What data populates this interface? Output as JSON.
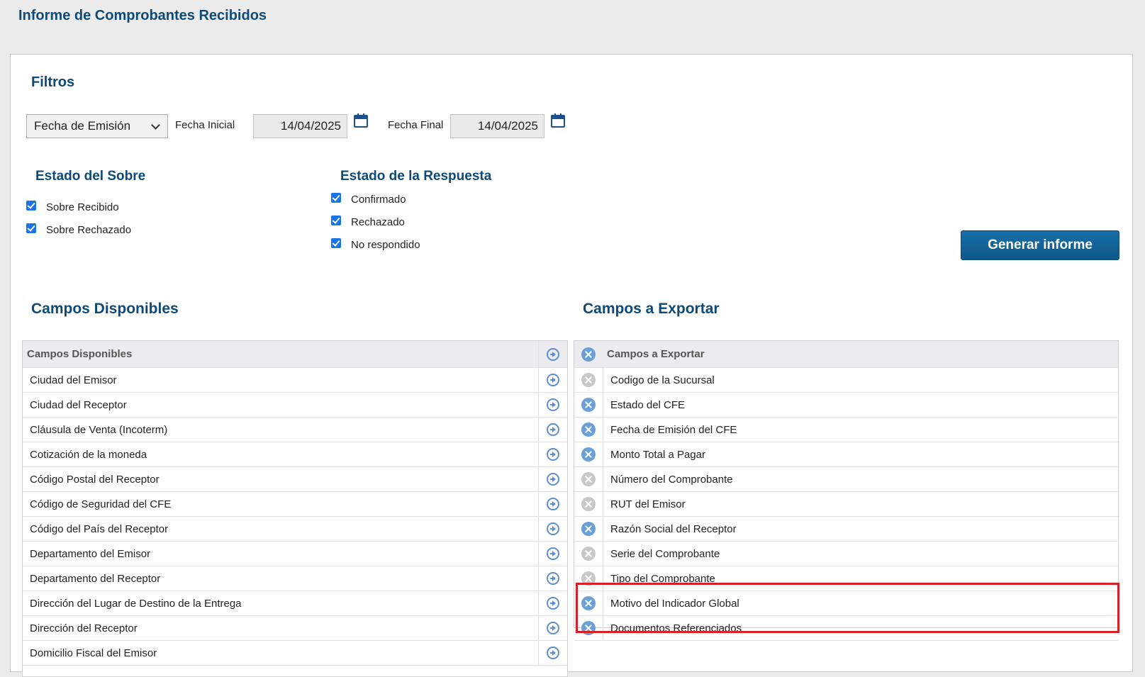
{
  "page_title": "Informe de Comprobantes Recibidos",
  "filters": {
    "title": "Filtros",
    "date_type_selected": "Fecha de Emisión",
    "start_label": "Fecha Inicial",
    "start_value": "14/04/2025",
    "end_label": "Fecha Final",
    "end_value": "14/04/2025"
  },
  "estado_sobre": {
    "title": "Estado del Sobre",
    "options": [
      {
        "label": "Sobre Recibido",
        "checked": true
      },
      {
        "label": "Sobre Rechazado",
        "checked": true
      }
    ]
  },
  "estado_respuesta": {
    "title": "Estado de la Respuesta",
    "options": [
      {
        "label": "Confirmado",
        "checked": true
      },
      {
        "label": "Rechazado",
        "checked": true
      },
      {
        "label": "No respondido",
        "checked": true
      }
    ]
  },
  "generate_button": "Generar informe",
  "available": {
    "title": "Campos Disponibles",
    "header": "Campos Disponibles",
    "items": [
      "Ciudad del Emisor",
      "Ciudad del Receptor",
      "Cláusula de Venta (Incoterm)",
      "Cotización de la moneda",
      "Código Postal del Receptor",
      "Código de Seguridad del CFE",
      "Código del País del Receptor",
      "Departamento del Emisor",
      "Departamento del Receptor",
      "Dirección del Lugar de Destino de la Entrega",
      "Dirección del Receptor",
      "Domicilio Fiscal del Emisor"
    ]
  },
  "export": {
    "title": "Campos a Exportar",
    "header": "Campos a Exportar",
    "items": [
      {
        "label": "Codigo de la Sucursal",
        "removable": false
      },
      {
        "label": "Estado del CFE",
        "removable": true
      },
      {
        "label": "Fecha de Emisión del CFE",
        "removable": true
      },
      {
        "label": "Monto Total a Pagar",
        "removable": true
      },
      {
        "label": "Número del Comprobante",
        "removable": false
      },
      {
        "label": "RUT del Emisor",
        "removable": false
      },
      {
        "label": "Razón Social del Receptor",
        "removable": true
      },
      {
        "label": "Serie del Comprobante",
        "removable": false
      },
      {
        "label": "Tipo del Comprobante",
        "removable": false
      },
      {
        "label": "Motivo del Indicador Global",
        "removable": true
      },
      {
        "label": "Documentos Referenciados",
        "removable": true
      }
    ]
  },
  "colors": {
    "accent": "#0d4a78",
    "highlight": "#d8202b",
    "remove_active": "#6a9fd8",
    "remove_disabled": "#c8c8c8"
  }
}
